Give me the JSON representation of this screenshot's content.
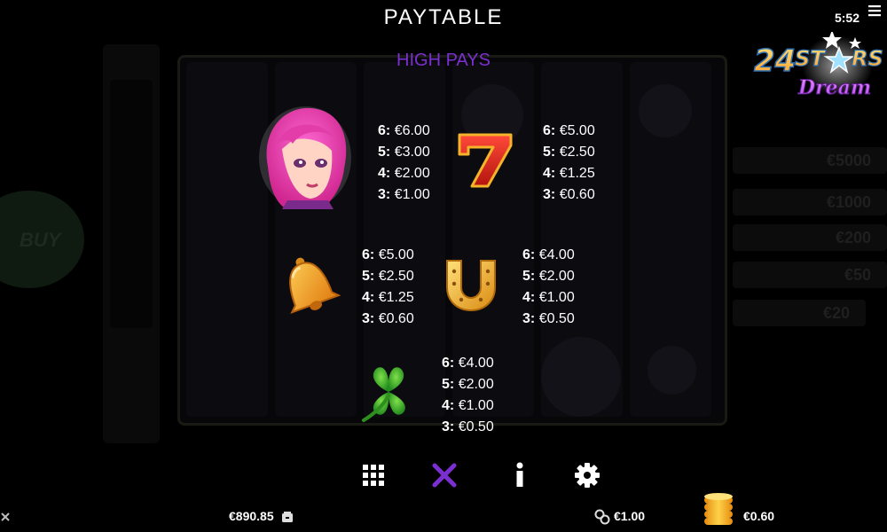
{
  "header": {
    "title": "PAYTABLE",
    "subtitle": "HIGH PAYS",
    "clock": "5:52"
  },
  "logo": {
    "line1": "24STARS",
    "line2": "Dream"
  },
  "paytable": [
    {
      "symbol": "girl",
      "icon": "pink-haired-girl-icon",
      "pays": [
        {
          "k": "6:",
          "v": "€6.00"
        },
        {
          "k": "5:",
          "v": "€3.00"
        },
        {
          "k": "4:",
          "v": "€2.00"
        },
        {
          "k": "3:",
          "v": "€1.00"
        }
      ]
    },
    {
      "symbol": "seven",
      "icon": "red-seven-icon",
      "pays": [
        {
          "k": "6:",
          "v": "€5.00"
        },
        {
          "k": "5:",
          "v": "€2.50"
        },
        {
          "k": "4:",
          "v": "€1.25"
        },
        {
          "k": "3:",
          "v": "€0.60"
        }
      ]
    },
    {
      "symbol": "bell",
      "icon": "golden-bell-icon",
      "pays": [
        {
          "k": "6:",
          "v": "€5.00"
        },
        {
          "k": "5:",
          "v": "€2.50"
        },
        {
          "k": "4:",
          "v": "€1.25"
        },
        {
          "k": "3:",
          "v": "€0.60"
        }
      ]
    },
    {
      "symbol": "horseshoe",
      "icon": "horseshoe-icon",
      "pays": [
        {
          "k": "6:",
          "v": "€4.00"
        },
        {
          "k": "5:",
          "v": "€2.00"
        },
        {
          "k": "4:",
          "v": "€1.00"
        },
        {
          "k": "3:",
          "v": "€0.50"
        }
      ]
    },
    {
      "symbol": "clover",
      "icon": "four-leaf-clover-icon",
      "pays": [
        {
          "k": "6:",
          "v": "€4.00"
        },
        {
          "k": "5:",
          "v": "€2.00"
        },
        {
          "k": "4:",
          "v": "€1.00"
        },
        {
          "k": "3:",
          "v": "€0.50"
        }
      ]
    }
  ],
  "toolbar": {
    "grid_icon": "grid-icon",
    "close_icon": "close-icon",
    "info_icon": "info-icon",
    "settings_icon": "gear-icon",
    "close_color": "#7b2fd0"
  },
  "bottom_bar": {
    "balance": "€890.85",
    "coin_value": "€1.00",
    "bet": "€0.60"
  },
  "background": {
    "buy_label": "BUY",
    "jackpots": [
      "€5000",
      "€1000",
      "€200",
      "€50",
      "€20"
    ]
  }
}
